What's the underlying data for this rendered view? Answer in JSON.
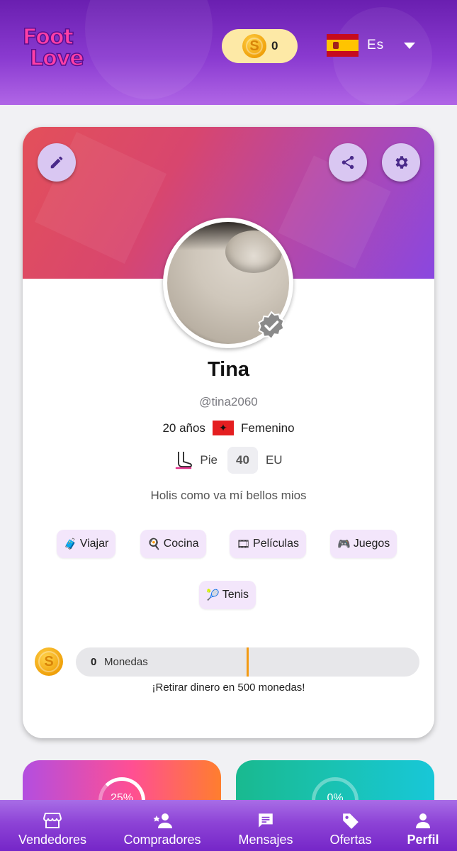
{
  "header": {
    "logo_line1": "Foot",
    "logo_line2": "Love",
    "coins": "0",
    "language": "Es",
    "icons": {
      "coin": "coin-icon",
      "flag": "spain-flag-icon",
      "dropdown": "chevron-down-icon"
    }
  },
  "profile": {
    "name": "Tina",
    "handle": "@tina2060",
    "age": "20 años",
    "gender": "Femenino",
    "foot_label": "Pie",
    "foot_size": "40",
    "foot_unit": "EU",
    "bio": "Holis como va mí bellos mios",
    "interests": [
      {
        "emoji": "🧳",
        "label": "Viajar"
      },
      {
        "emoji": "🍳",
        "label": "Cocina"
      },
      {
        "emoji": "🎞",
        "label": "Películas"
      },
      {
        "emoji": "🎮",
        "label": "Juegos"
      },
      {
        "emoji": "🎾",
        "label": "Tenis"
      }
    ],
    "coins_value": "0",
    "coins_label": "Monedas",
    "coins_progress_fraction": 0,
    "withdraw_text": "¡Retirar dinero en 500 monedas!"
  },
  "stats": [
    {
      "percent": "25%",
      "value": 0.25
    },
    {
      "percent": "0%",
      "value": 0
    }
  ],
  "nav": {
    "items": [
      {
        "label": "Vendedores",
        "icon": "store-icon"
      },
      {
        "label": "Compradores",
        "icon": "users-icon"
      },
      {
        "label": "Mensajes",
        "icon": "message-icon"
      },
      {
        "label": "Ofertas",
        "icon": "tag-icon"
      },
      {
        "label": "Perfil",
        "icon": "person-icon"
      }
    ],
    "active": "Perfil"
  },
  "colors": {
    "brand_purple": "#7526c8",
    "accent_pink": "#ff3fa6",
    "coin_gold": "#f0a10a",
    "progress_marker": "#f39a12"
  }
}
